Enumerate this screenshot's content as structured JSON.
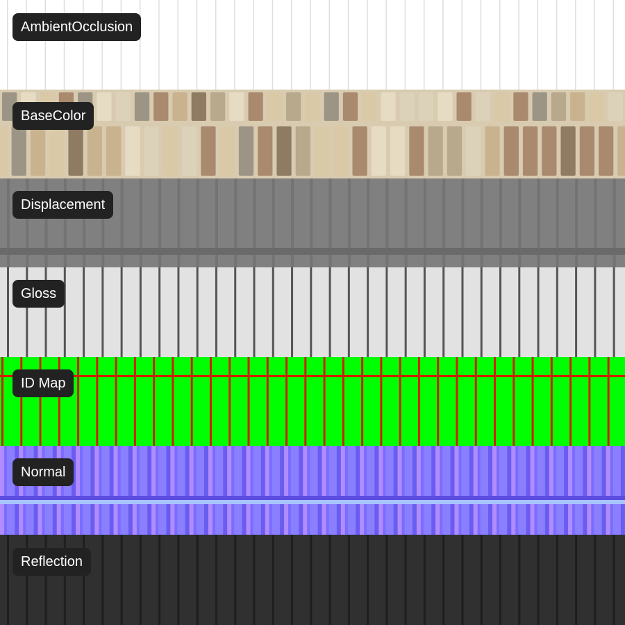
{
  "maps": [
    {
      "label": "AmbientOcclusion",
      "kind": "ao",
      "base": "#ffffff",
      "line": "#dedede"
    },
    {
      "label": "BaseColor",
      "kind": "color",
      "base": "#d8cbb0",
      "line": "#b8a98c"
    },
    {
      "label": "Displacement",
      "kind": "disp",
      "base": "#808080",
      "line": "#6e6e6e"
    },
    {
      "label": "Gloss",
      "kind": "gloss",
      "base": "#e2e2e2",
      "line": "#555555"
    },
    {
      "label": "ID Map",
      "kind": "id",
      "base": "#00ff00",
      "line": "#cc2200"
    },
    {
      "label": "Normal",
      "kind": "normal",
      "base": "#8a80ff",
      "line": "#5a4de0"
    },
    {
      "label": "Reflection",
      "kind": "refl",
      "base": "#303030",
      "line": "#1e1e1e"
    }
  ],
  "colors": {
    "label_bg": "#222222",
    "label_text": "#ffffff",
    "tile_palette": [
      "#e6dcc3",
      "#d9c9a6",
      "#c9b38f",
      "#a98a6e",
      "#9c9585",
      "#b8a98c",
      "#8f7a62",
      "#dcd2ba"
    ]
  }
}
